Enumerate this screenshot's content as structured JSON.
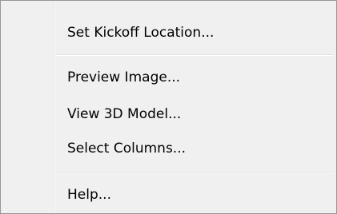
{
  "menu": {
    "items": [
      {
        "label": "Set Kickoff Location..."
      },
      {
        "label": "Preview Image..."
      },
      {
        "label": "View 3D Model..."
      },
      {
        "label": "Select Columns..."
      },
      {
        "label": "Help..."
      }
    ]
  }
}
